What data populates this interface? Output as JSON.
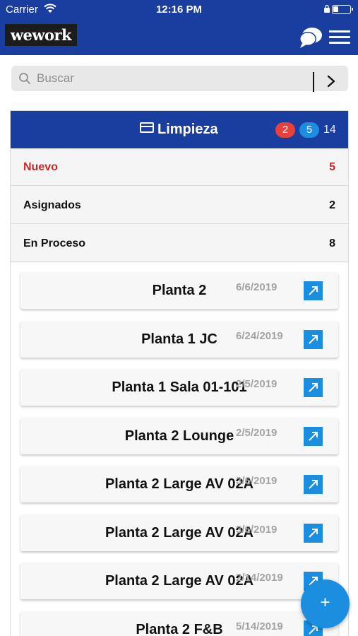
{
  "status_bar": {
    "carrier": "Carrier",
    "time": "12:16 PM"
  },
  "nav": {
    "logo_text": "wework",
    "chat_icon": "chat-bubbles-icon",
    "menu_icon": "hamburger-menu-icon"
  },
  "search": {
    "placeholder": "Buscar",
    "value": ""
  },
  "panel": {
    "icon": "card-icon",
    "title": "Limpieza",
    "badge_red": "2",
    "badge_blue": "5",
    "total": "14",
    "colors": {
      "header": "#1a3ea0",
      "badge_red": "#e8413c",
      "badge_blue": "#1b8ee0",
      "nuevo": "#c62828"
    }
  },
  "statuses": [
    {
      "label": "Nuevo",
      "count": "5"
    },
    {
      "label": "Asignados",
      "count": "2"
    },
    {
      "label": "En Proceso",
      "count": "8"
    }
  ],
  "items": [
    {
      "title": "Planta 2",
      "date": "6/6/2019"
    },
    {
      "title": "Planta 1 JC",
      "date": "6/24/2019"
    },
    {
      "title": "Planta 1 Sala 01-101",
      "date": "2/5/2019"
    },
    {
      "title": "Planta 2 Lounge",
      "date": "2/5/2019"
    },
    {
      "title": "Planta 2 Large AV 02A",
      "date": "3/6/2019"
    },
    {
      "title": "Planta 2 Large AV 02A",
      "date": "3/6/2019"
    },
    {
      "title": "Planta 2 Large AV 02A",
      "date": "2/14/2019"
    },
    {
      "title": "Planta 2 F&B",
      "date": "5/14/2019"
    }
  ],
  "fab": {
    "label": "+"
  }
}
